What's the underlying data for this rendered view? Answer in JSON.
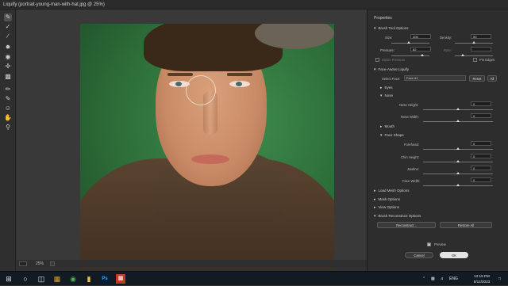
{
  "window": {
    "title": "Liquify (portrait-young-man-with-hat.jpg @ 25%)"
  },
  "status": {
    "zoom": "25%"
  },
  "panel": {
    "title": "Properties",
    "brush_tool_options": {
      "header": "Brush Tool Options",
      "size_label": "Size:",
      "size_value": "406",
      "size_level": 0.45,
      "density_label": "Density:",
      "density_value": "50",
      "density_level": 0.5,
      "pressure_label": "Pressure:",
      "pressure_value": "82",
      "pressure_level": 0.82,
      "rate_label": "Rate:",
      "rate_value": "",
      "rate_level": 0.2,
      "stylus_pressure_label": "Stylus Pressure",
      "pin_edges_label": "Pin Edges"
    },
    "face_aware": {
      "header": "Face-Aware Liquify",
      "select_face_label": "Select Face:",
      "select_face_value": "Face #1",
      "reset_label": "Reset",
      "all_label": "All",
      "eyes_label": "Eyes",
      "nose_label": "Nose",
      "nose_height_label": "Nose Height:",
      "nose_height_value": "0",
      "nose_width_label": "Nose Width:",
      "nose_width_value": "0",
      "mouth_label": "Mouth",
      "face_shape_label": "Face Shape",
      "forehead_label": "Forehead:",
      "forehead_value": "0",
      "chin_height_label": "Chin Height:",
      "chin_height_value": "0",
      "jawline_label": "Jawline:",
      "jawline_value": "0",
      "face_width_label": "Face Width:",
      "face_width_value": "0"
    },
    "load_mesh": "Load Mesh Options",
    "mask_options": "Mask Options",
    "view_options": "View Options",
    "reconstruct": {
      "header": "Brush Reconstruct Options",
      "reconstruct_btn": "Reconstruct...",
      "restore_all_btn": "Restore All"
    },
    "preview_label": "Preview",
    "cancel_label": "Cancel",
    "ok_label": "OK"
  },
  "taskbar": {
    "language": "ENG",
    "time": "12:15 PM",
    "date": "8/12/2023"
  }
}
